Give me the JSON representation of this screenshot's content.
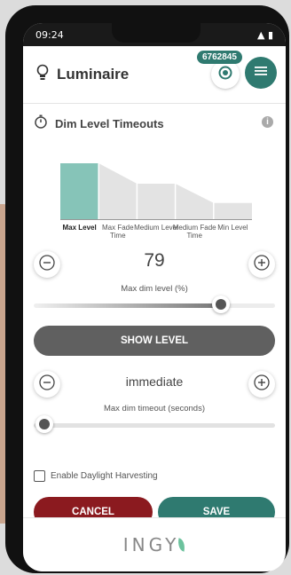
{
  "status_bar": {
    "time": "09:24"
  },
  "header": {
    "title": "Luminaire",
    "badge": "6762845",
    "icons": {
      "bulb": "lightbulb-icon",
      "target": "target-icon",
      "menu": "menu-icon"
    }
  },
  "section": {
    "title": "Dim Level Timeouts",
    "icon": "stopwatch-icon"
  },
  "timeline": {
    "labels": [
      {
        "text": "Max Level",
        "active": true
      },
      {
        "text": "Max Fade Time",
        "active": false
      },
      {
        "text": "Medium Level",
        "active": false
      },
      {
        "text": "Medium Fade Time",
        "active": false
      },
      {
        "text": "Min Level",
        "active": false
      }
    ],
    "levels": [
      1.0,
      1.0,
      0.64,
      0.64,
      0.3
    ],
    "ylim": [
      0,
      1
    ],
    "colors": {
      "active": "#86c4b8",
      "inactive": "#e3e3e3"
    }
  },
  "dim_level": {
    "value": "79",
    "caption": "Max dim level (%)",
    "slider_fraction": 0.79
  },
  "show_level_label": "SHOW LEVEL",
  "dim_timeout": {
    "value": "immediate",
    "caption": "Max dim timeout (seconds)",
    "slider_fraction": 0.0
  },
  "daylight": {
    "label": "Enable Daylight Harvesting",
    "checked": false
  },
  "buttons": {
    "cancel": "CANCEL",
    "save": "SAVE"
  },
  "footer": {
    "logo_text": "INGY"
  },
  "colors": {
    "accent": "#2f7a70",
    "danger": "#8b1a1f",
    "neutral": "#606060"
  }
}
